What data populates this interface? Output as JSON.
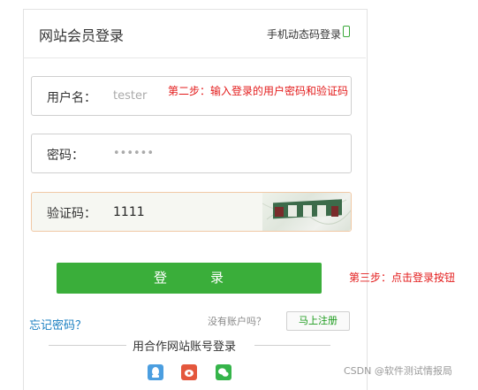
{
  "header": {
    "title": "网站会员登录",
    "sms_login": "手机动态码登录"
  },
  "form": {
    "username_label": "用户名：",
    "username_value": "tester",
    "password_label": "密码：",
    "password_value": "••••••",
    "captcha_label": "验证码：",
    "captcha_value": "1111"
  },
  "annotations": {
    "step2": "第二步：输入登录的用户密码和验证码",
    "step3": "第三步：点击登录按钮"
  },
  "login_button": "登　　　录",
  "forgot_password": "忘记密码？",
  "no_account": "没有账户吗？",
  "register_button": "马上注册",
  "partner_login": "用合作网站账号登录",
  "social_icons": [
    "qq-icon",
    "weibo-icon",
    "wechat-icon"
  ],
  "watermark": "CSDN @软件测试情报局",
  "colors": {
    "primary_green": "#3aae3a",
    "link_blue": "#1a7fc1",
    "annotation_red": "#e31b1b"
  }
}
